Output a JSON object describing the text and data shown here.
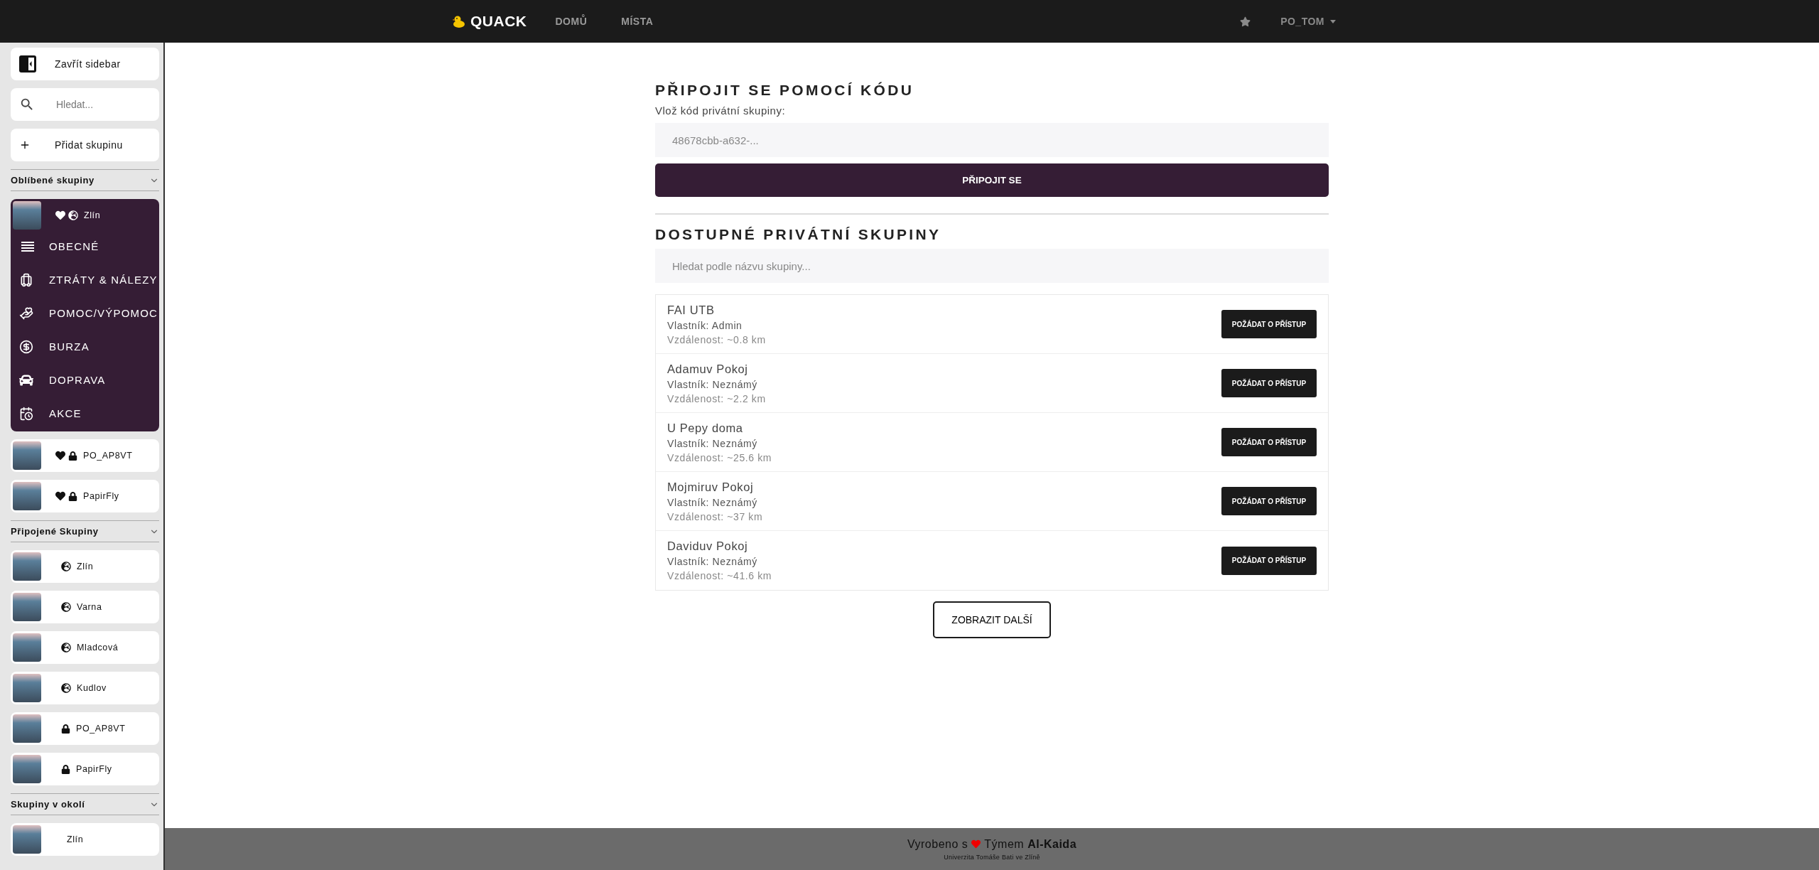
{
  "navbar": {
    "brand": "QUACK",
    "links": [
      {
        "label": "DOMŮ",
        "selected": false
      },
      {
        "label": "MÍSTA",
        "selected": false
      }
    ],
    "user": "PO_TOM"
  },
  "sidebar": {
    "close_label": "Zavřít sidebar",
    "search": {
      "placeholder": "Hledat..."
    },
    "add_label": "Přidat skupinu",
    "sections": [
      {
        "title": "Oblíbené skupiny",
        "expanded": true,
        "groups": [
          {
            "name": "Zlín",
            "favorite": true,
            "public": true,
            "locked": false,
            "expanded": true,
            "categories": [
              {
                "kind": "general",
                "label": "OBECNÉ"
              },
              {
                "kind": "lost",
                "label": "ZTRÁTY & NÁLEZY"
              },
              {
                "kind": "help",
                "label": "POMOC/VÝPOMOC"
              },
              {
                "kind": "exchange",
                "label": "BURZA"
              },
              {
                "kind": "transport",
                "label": "DOPRAVA"
              },
              {
                "kind": "event",
                "label": "AKCE"
              }
            ]
          },
          {
            "name": "PO_AP8VT",
            "favorite": true,
            "public": false,
            "locked": true,
            "expanded": false
          },
          {
            "name": "PapirFly",
            "favorite": true,
            "public": false,
            "locked": true,
            "expanded": false
          }
        ]
      },
      {
        "title": "Připojené Skupiny",
        "expanded": true,
        "groups": [
          {
            "name": "Zlín",
            "favorite": false,
            "public": true,
            "locked": false,
            "expanded": false
          },
          {
            "name": "Varna",
            "favorite": false,
            "public": true,
            "locked": false,
            "expanded": false
          },
          {
            "name": "Mladcová",
            "favorite": false,
            "public": true,
            "locked": false,
            "expanded": false
          },
          {
            "name": "Kudlov",
            "favorite": false,
            "public": true,
            "locked": false,
            "expanded": false
          },
          {
            "name": "PO_AP8VT",
            "favorite": false,
            "public": false,
            "locked": true,
            "expanded": false
          },
          {
            "name": "PapirFly",
            "favorite": false,
            "public": false,
            "locked": true,
            "expanded": false
          }
        ]
      },
      {
        "title": "Skupiny v okolí",
        "expanded": true,
        "groups": [
          {
            "name": "Zlín",
            "favorite": false,
            "public": false,
            "locked": false,
            "expanded": false
          }
        ]
      }
    ]
  },
  "join": {
    "title": "PŘIPOJIT SE POMOCÍ KÓDU",
    "label": "Vlož kód privátní skupiny:",
    "code_field": {
      "placeholder": "48678cbb-a632-..."
    },
    "button": "PŘIPOJIT SE"
  },
  "available": {
    "title": "DOSTUPNÉ PRIVÁTNÍ SKUPINY",
    "search": {
      "placeholder": "Hledat podle názvu skupiny..."
    },
    "groups": [
      {
        "name": "FAI UTB",
        "owner": "Vlastník: Admin",
        "distance": "Vzdálenost: ~0.8 km",
        "button": "POŽÁDAT O PŘÍSTUP"
      },
      {
        "name": "Adamuv Pokoj",
        "owner": "Vlastník: Neznámý",
        "distance": "Vzdálenost: ~2.2 km",
        "button": "POŽÁDAT O PŘÍSTUP"
      },
      {
        "name": "U Pepy doma",
        "owner": "Vlastník: Neznámý",
        "distance": "Vzdálenost: ~25.6 km",
        "button": "POŽÁDAT O PŘÍSTUP"
      },
      {
        "name": "Mojmiruv Pokoj",
        "owner": "Vlastník: Neznámý",
        "distance": "Vzdálenost: ~37 km",
        "button": "POŽÁDAT O PŘÍSTUP"
      },
      {
        "name": "Daviduv Pokoj",
        "owner": "Vlastník: Neznámý",
        "distance": "Vzdálenost: ~41.6 km",
        "button": "POŽÁDAT O PŘÍSTUP"
      }
    ],
    "more_button": "ZOBRAZIT DALŠÍ"
  },
  "footer": {
    "line": "Vyrobeno s",
    "team_prefix": "Týmem",
    "team": "Al-Kaida",
    "university": "Univerzita Tomáše Bati ve Zlíně"
  }
}
